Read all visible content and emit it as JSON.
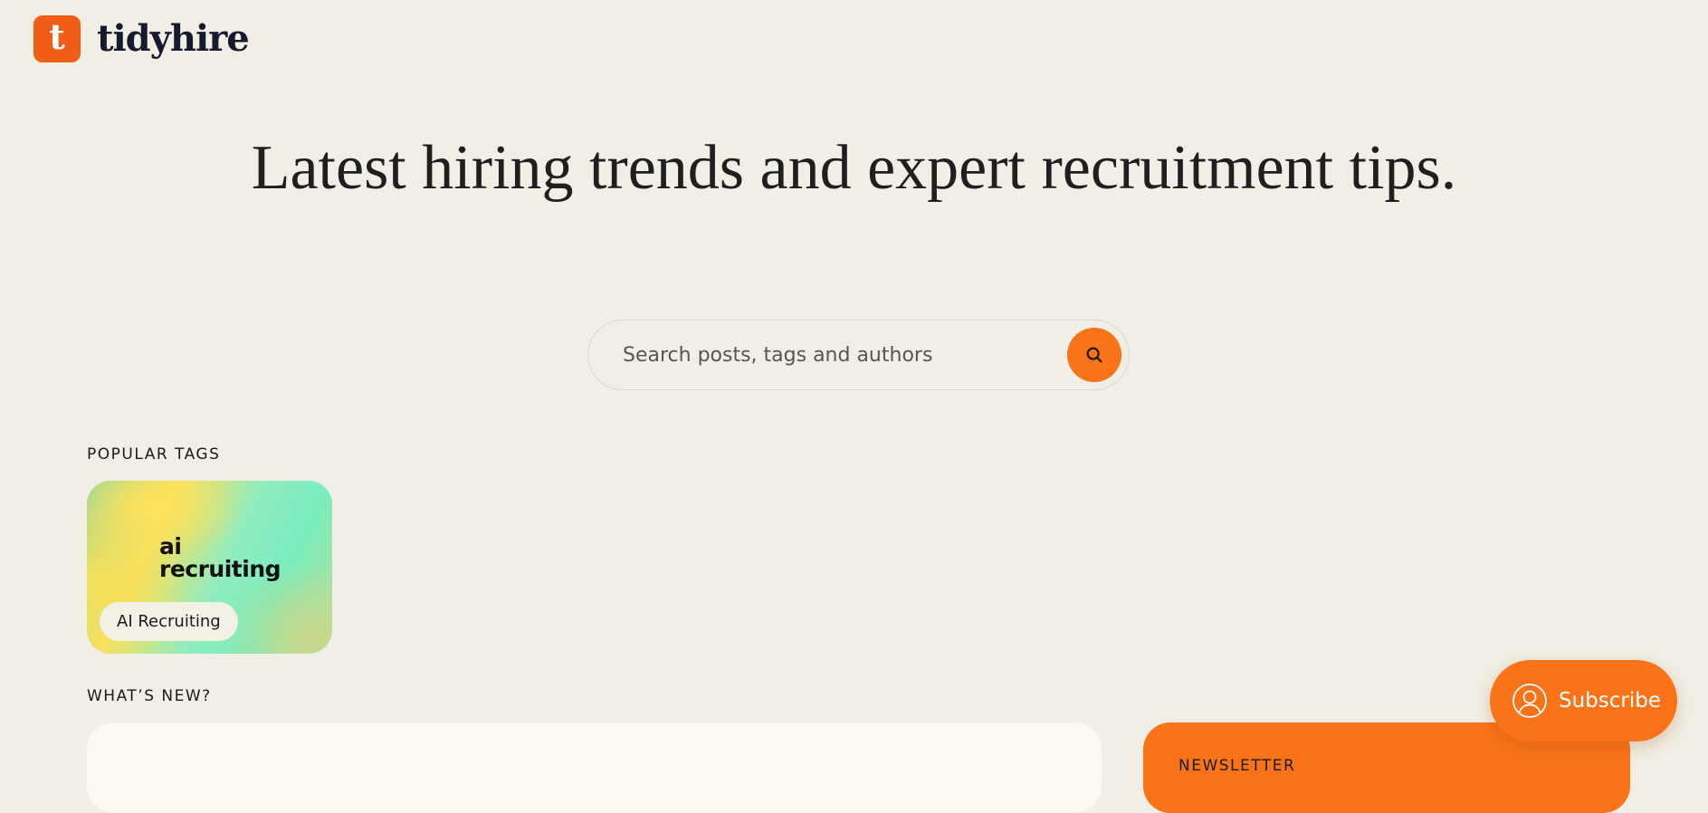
{
  "brand": {
    "logo_letter": "t",
    "name": "tidyhire",
    "accent_color": "#fa7319"
  },
  "hero": {
    "title": "Latest hiring trends and expert recruitment tips."
  },
  "search": {
    "placeholder": "Search posts, tags and authors",
    "value": "",
    "button_icon": "search-icon"
  },
  "popular_tags": {
    "label": "POPULAR TAGS",
    "tags": [
      {
        "art_line_1": "ai",
        "art_line_2": "recruiting",
        "name": "AI Recruiting"
      }
    ]
  },
  "whats_new": {
    "label": "WHAT’S NEW?"
  },
  "newsletter": {
    "label": "NEWSLETTER"
  },
  "subscribe": {
    "label": "Subscribe",
    "icon": "user-circle-icon"
  }
}
